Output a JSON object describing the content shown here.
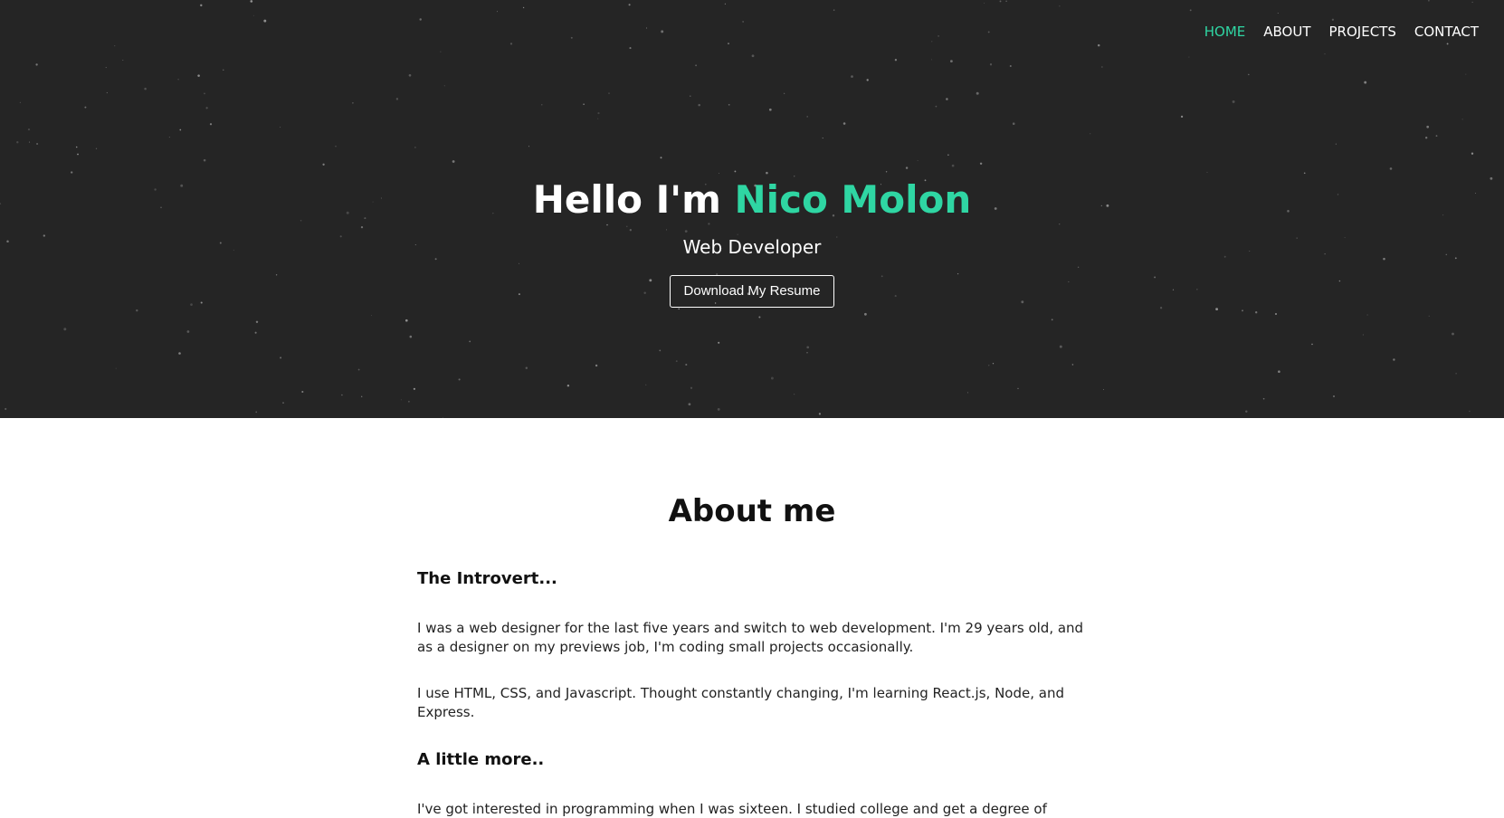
{
  "nav": {
    "items": [
      {
        "label": "HOME",
        "active": true
      },
      {
        "label": "ABOUT",
        "active": false
      },
      {
        "label": "PROJECTS",
        "active": false
      },
      {
        "label": "CONTACT",
        "active": false
      }
    ]
  },
  "hero": {
    "greeting": "Hello I'm ",
    "name": "Nico Molon",
    "subtitle": "Web Developer",
    "resume_button": "Download My Resume"
  },
  "about": {
    "title": "About me",
    "section1_heading": "The Introvert...",
    "section1_paragraph1": "I was a web designer for the last five years and switch to web development. I'm 29 years old, and as a designer on my previews job, I'm coding small projects occasionally.",
    "section1_paragraph2": "I use HTML, CSS, and Javascript. Thought constantly changing, I'm learning React.js, Node, and Express.",
    "section2_heading": "A little more..",
    "section2_paragraph1": "I've got interested in programming when I was sixteen. I studied college and get a degree of Bachelor of Science in Information Technology. When I graduated, life is not easy as I thought. I can't find a job as a"
  },
  "colors": {
    "accent": "#2fd6a3",
    "hero_bg": "#252525"
  }
}
